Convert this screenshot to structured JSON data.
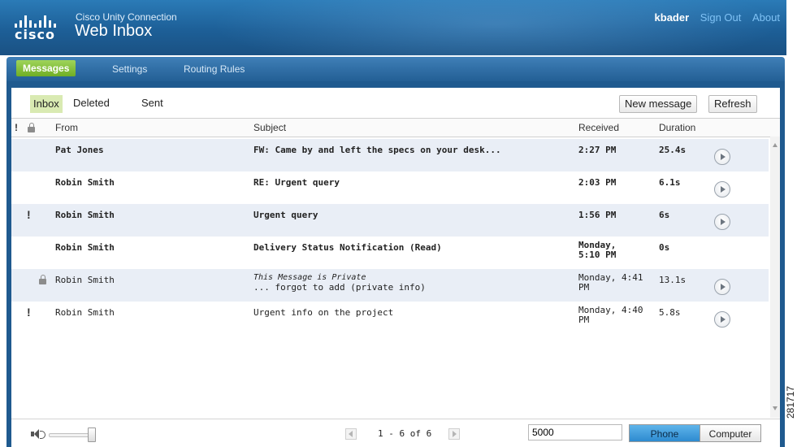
{
  "header": {
    "product_name": "Cisco Unity Connection",
    "app_title": "Web Inbox",
    "logo_text": "cisco",
    "username": "kbader",
    "sign_out": "Sign Out",
    "about": "About"
  },
  "nav": {
    "tabs": [
      {
        "label": "Messages",
        "active": true
      },
      {
        "label": "Settings",
        "active": false
      },
      {
        "label": "Routing Rules",
        "active": false
      }
    ]
  },
  "toolbar": {
    "folders": [
      {
        "label": "Inbox",
        "active": true
      },
      {
        "label": "Deleted",
        "active": false
      },
      {
        "label": "Sent",
        "active": false
      }
    ],
    "new_message": "New message",
    "refresh": "Refresh"
  },
  "table": {
    "priority_header": "!",
    "columns": {
      "from": "From",
      "subject": "Subject",
      "received": "Received",
      "duration": "Duration"
    },
    "rows": [
      {
        "from": "Pat Jones",
        "subject": "FW: Came by and left the specs on your desk...",
        "received": "2:27 PM",
        "duration": "25.4s",
        "unread": true,
        "urgent": false,
        "private": false,
        "playable": true
      },
      {
        "from": "Robin Smith",
        "subject": "RE: Urgent query",
        "received": "2:03 PM",
        "duration": "6.1s",
        "unread": true,
        "urgent": false,
        "private": false,
        "playable": true
      },
      {
        "from": "Robin Smith",
        "subject": "Urgent query",
        "received": "1:56 PM",
        "duration": "6s",
        "unread": true,
        "urgent": true,
        "private": false,
        "playable": true
      },
      {
        "from": "Robin Smith",
        "subject": "Delivery Status Notification (Read)",
        "received_line1": "Monday,",
        "received_line2": "5:10 PM",
        "duration": "0s",
        "unread": true,
        "urgent": false,
        "private": false,
        "playable": false
      },
      {
        "from": "Robin Smith",
        "private_label": "This Message is Private",
        "subject": "... forgot to add (private info)",
        "received_line1": "Monday, 4:41",
        "received_line2": "PM",
        "duration": "13.1s",
        "unread": false,
        "urgent": false,
        "private": true,
        "playable": true
      },
      {
        "from": "Robin Smith",
        "subject": "Urgent info on the project",
        "received_line1": "Monday, 4:40",
        "received_line2": "PM",
        "duration": "5.8s",
        "unread": false,
        "urgent": true,
        "private": false,
        "playable": true
      }
    ]
  },
  "footer": {
    "pagination": "1 - 6 of 6",
    "number_value": "5000",
    "phone": "Phone",
    "computer": "Computer",
    "volume_level": 0.85
  },
  "side_label": "281717",
  "icons": {
    "priority": "exclamation-icon",
    "private": "lock-icon",
    "play": "play-icon",
    "volume": "speaker-icon"
  },
  "colors": {
    "header_blue": "#1d5f97",
    "active_green": "#7fbf34",
    "row_alt": "#e9eef6",
    "toggle_blue": "#3a9ee0"
  }
}
